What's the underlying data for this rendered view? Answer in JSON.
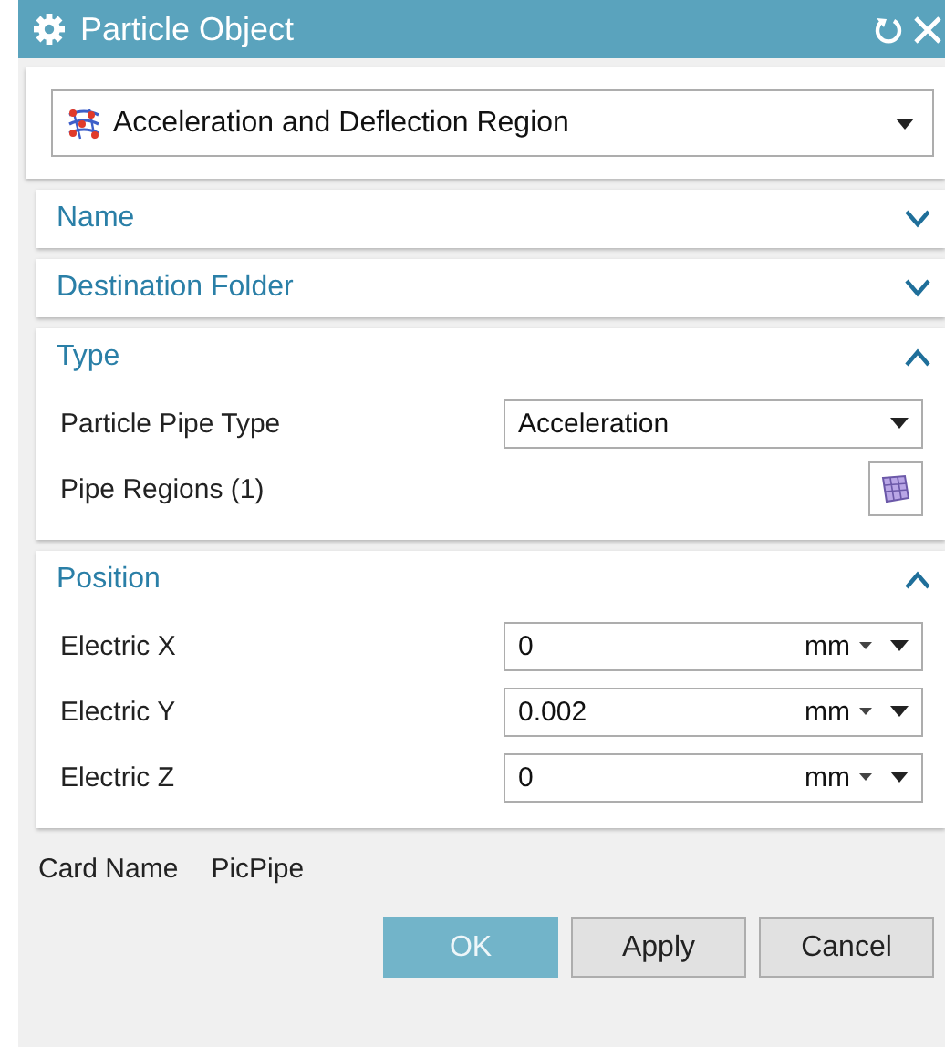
{
  "window": {
    "title": "Particle Object"
  },
  "object_type": {
    "value": "Acceleration and Deflection Region"
  },
  "sections": [
    {
      "title": "Name",
      "expanded": false
    },
    {
      "title": "Destination Folder",
      "expanded": false
    },
    {
      "title": "Type",
      "expanded": true,
      "rows": [
        {
          "kind": "select",
          "label": "Particle Pipe Type",
          "value": "Acceleration"
        },
        {
          "kind": "list-button",
          "label": "Pipe Regions (1)"
        }
      ]
    },
    {
      "title": "Position",
      "expanded": true,
      "rows": [
        {
          "kind": "unit",
          "label": "Electric X",
          "value": "0",
          "unit": "mm"
        },
        {
          "kind": "unit",
          "label": "Electric Y",
          "value": "0.002",
          "unit": "mm"
        },
        {
          "kind": "unit",
          "label": "Electric Z",
          "value": "0",
          "unit": "mm"
        }
      ]
    }
  ],
  "card_name": {
    "label": "Card Name",
    "value": "PicPipe"
  },
  "buttons": [
    {
      "label": "OK",
      "default": true
    },
    {
      "label": "Apply",
      "default": false
    },
    {
      "label": "Cancel",
      "default": false
    }
  ]
}
